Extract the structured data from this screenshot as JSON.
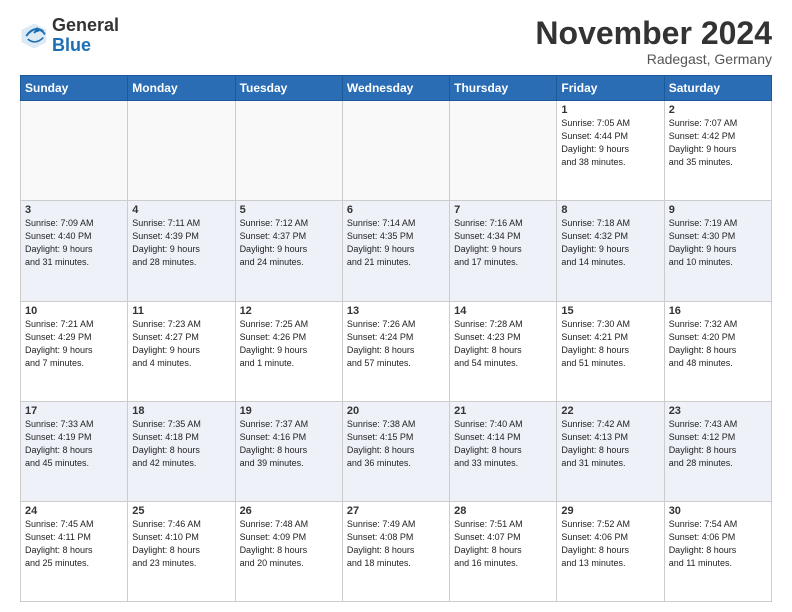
{
  "header": {
    "logo_general": "General",
    "logo_blue": "Blue",
    "title": "November 2024",
    "location": "Radegast, Germany"
  },
  "days_of_week": [
    "Sunday",
    "Monday",
    "Tuesday",
    "Wednesday",
    "Thursday",
    "Friday",
    "Saturday"
  ],
  "weeks": [
    [
      {
        "day": "",
        "info": ""
      },
      {
        "day": "",
        "info": ""
      },
      {
        "day": "",
        "info": ""
      },
      {
        "day": "",
        "info": ""
      },
      {
        "day": "",
        "info": ""
      },
      {
        "day": "1",
        "info": "Sunrise: 7:05 AM\nSunset: 4:44 PM\nDaylight: 9 hours\nand 38 minutes."
      },
      {
        "day": "2",
        "info": "Sunrise: 7:07 AM\nSunset: 4:42 PM\nDaylight: 9 hours\nand 35 minutes."
      }
    ],
    [
      {
        "day": "3",
        "info": "Sunrise: 7:09 AM\nSunset: 4:40 PM\nDaylight: 9 hours\nand 31 minutes."
      },
      {
        "day": "4",
        "info": "Sunrise: 7:11 AM\nSunset: 4:39 PM\nDaylight: 9 hours\nand 28 minutes."
      },
      {
        "day": "5",
        "info": "Sunrise: 7:12 AM\nSunset: 4:37 PM\nDaylight: 9 hours\nand 24 minutes."
      },
      {
        "day": "6",
        "info": "Sunrise: 7:14 AM\nSunset: 4:35 PM\nDaylight: 9 hours\nand 21 minutes."
      },
      {
        "day": "7",
        "info": "Sunrise: 7:16 AM\nSunset: 4:34 PM\nDaylight: 9 hours\nand 17 minutes."
      },
      {
        "day": "8",
        "info": "Sunrise: 7:18 AM\nSunset: 4:32 PM\nDaylight: 9 hours\nand 14 minutes."
      },
      {
        "day": "9",
        "info": "Sunrise: 7:19 AM\nSunset: 4:30 PM\nDaylight: 9 hours\nand 10 minutes."
      }
    ],
    [
      {
        "day": "10",
        "info": "Sunrise: 7:21 AM\nSunset: 4:29 PM\nDaylight: 9 hours\nand 7 minutes."
      },
      {
        "day": "11",
        "info": "Sunrise: 7:23 AM\nSunset: 4:27 PM\nDaylight: 9 hours\nand 4 minutes."
      },
      {
        "day": "12",
        "info": "Sunrise: 7:25 AM\nSunset: 4:26 PM\nDaylight: 9 hours\nand 1 minute."
      },
      {
        "day": "13",
        "info": "Sunrise: 7:26 AM\nSunset: 4:24 PM\nDaylight: 8 hours\nand 57 minutes."
      },
      {
        "day": "14",
        "info": "Sunrise: 7:28 AM\nSunset: 4:23 PM\nDaylight: 8 hours\nand 54 minutes."
      },
      {
        "day": "15",
        "info": "Sunrise: 7:30 AM\nSunset: 4:21 PM\nDaylight: 8 hours\nand 51 minutes."
      },
      {
        "day": "16",
        "info": "Sunrise: 7:32 AM\nSunset: 4:20 PM\nDaylight: 8 hours\nand 48 minutes."
      }
    ],
    [
      {
        "day": "17",
        "info": "Sunrise: 7:33 AM\nSunset: 4:19 PM\nDaylight: 8 hours\nand 45 minutes."
      },
      {
        "day": "18",
        "info": "Sunrise: 7:35 AM\nSunset: 4:18 PM\nDaylight: 8 hours\nand 42 minutes."
      },
      {
        "day": "19",
        "info": "Sunrise: 7:37 AM\nSunset: 4:16 PM\nDaylight: 8 hours\nand 39 minutes."
      },
      {
        "day": "20",
        "info": "Sunrise: 7:38 AM\nSunset: 4:15 PM\nDaylight: 8 hours\nand 36 minutes."
      },
      {
        "day": "21",
        "info": "Sunrise: 7:40 AM\nSunset: 4:14 PM\nDaylight: 8 hours\nand 33 minutes."
      },
      {
        "day": "22",
        "info": "Sunrise: 7:42 AM\nSunset: 4:13 PM\nDaylight: 8 hours\nand 31 minutes."
      },
      {
        "day": "23",
        "info": "Sunrise: 7:43 AM\nSunset: 4:12 PM\nDaylight: 8 hours\nand 28 minutes."
      }
    ],
    [
      {
        "day": "24",
        "info": "Sunrise: 7:45 AM\nSunset: 4:11 PM\nDaylight: 8 hours\nand 25 minutes."
      },
      {
        "day": "25",
        "info": "Sunrise: 7:46 AM\nSunset: 4:10 PM\nDaylight: 8 hours\nand 23 minutes."
      },
      {
        "day": "26",
        "info": "Sunrise: 7:48 AM\nSunset: 4:09 PM\nDaylight: 8 hours\nand 20 minutes."
      },
      {
        "day": "27",
        "info": "Sunrise: 7:49 AM\nSunset: 4:08 PM\nDaylight: 8 hours\nand 18 minutes."
      },
      {
        "day": "28",
        "info": "Sunrise: 7:51 AM\nSunset: 4:07 PM\nDaylight: 8 hours\nand 16 minutes."
      },
      {
        "day": "29",
        "info": "Sunrise: 7:52 AM\nSunset: 4:06 PM\nDaylight: 8 hours\nand 13 minutes."
      },
      {
        "day": "30",
        "info": "Sunrise: 7:54 AM\nSunset: 4:06 PM\nDaylight: 8 hours\nand 11 minutes."
      }
    ]
  ]
}
